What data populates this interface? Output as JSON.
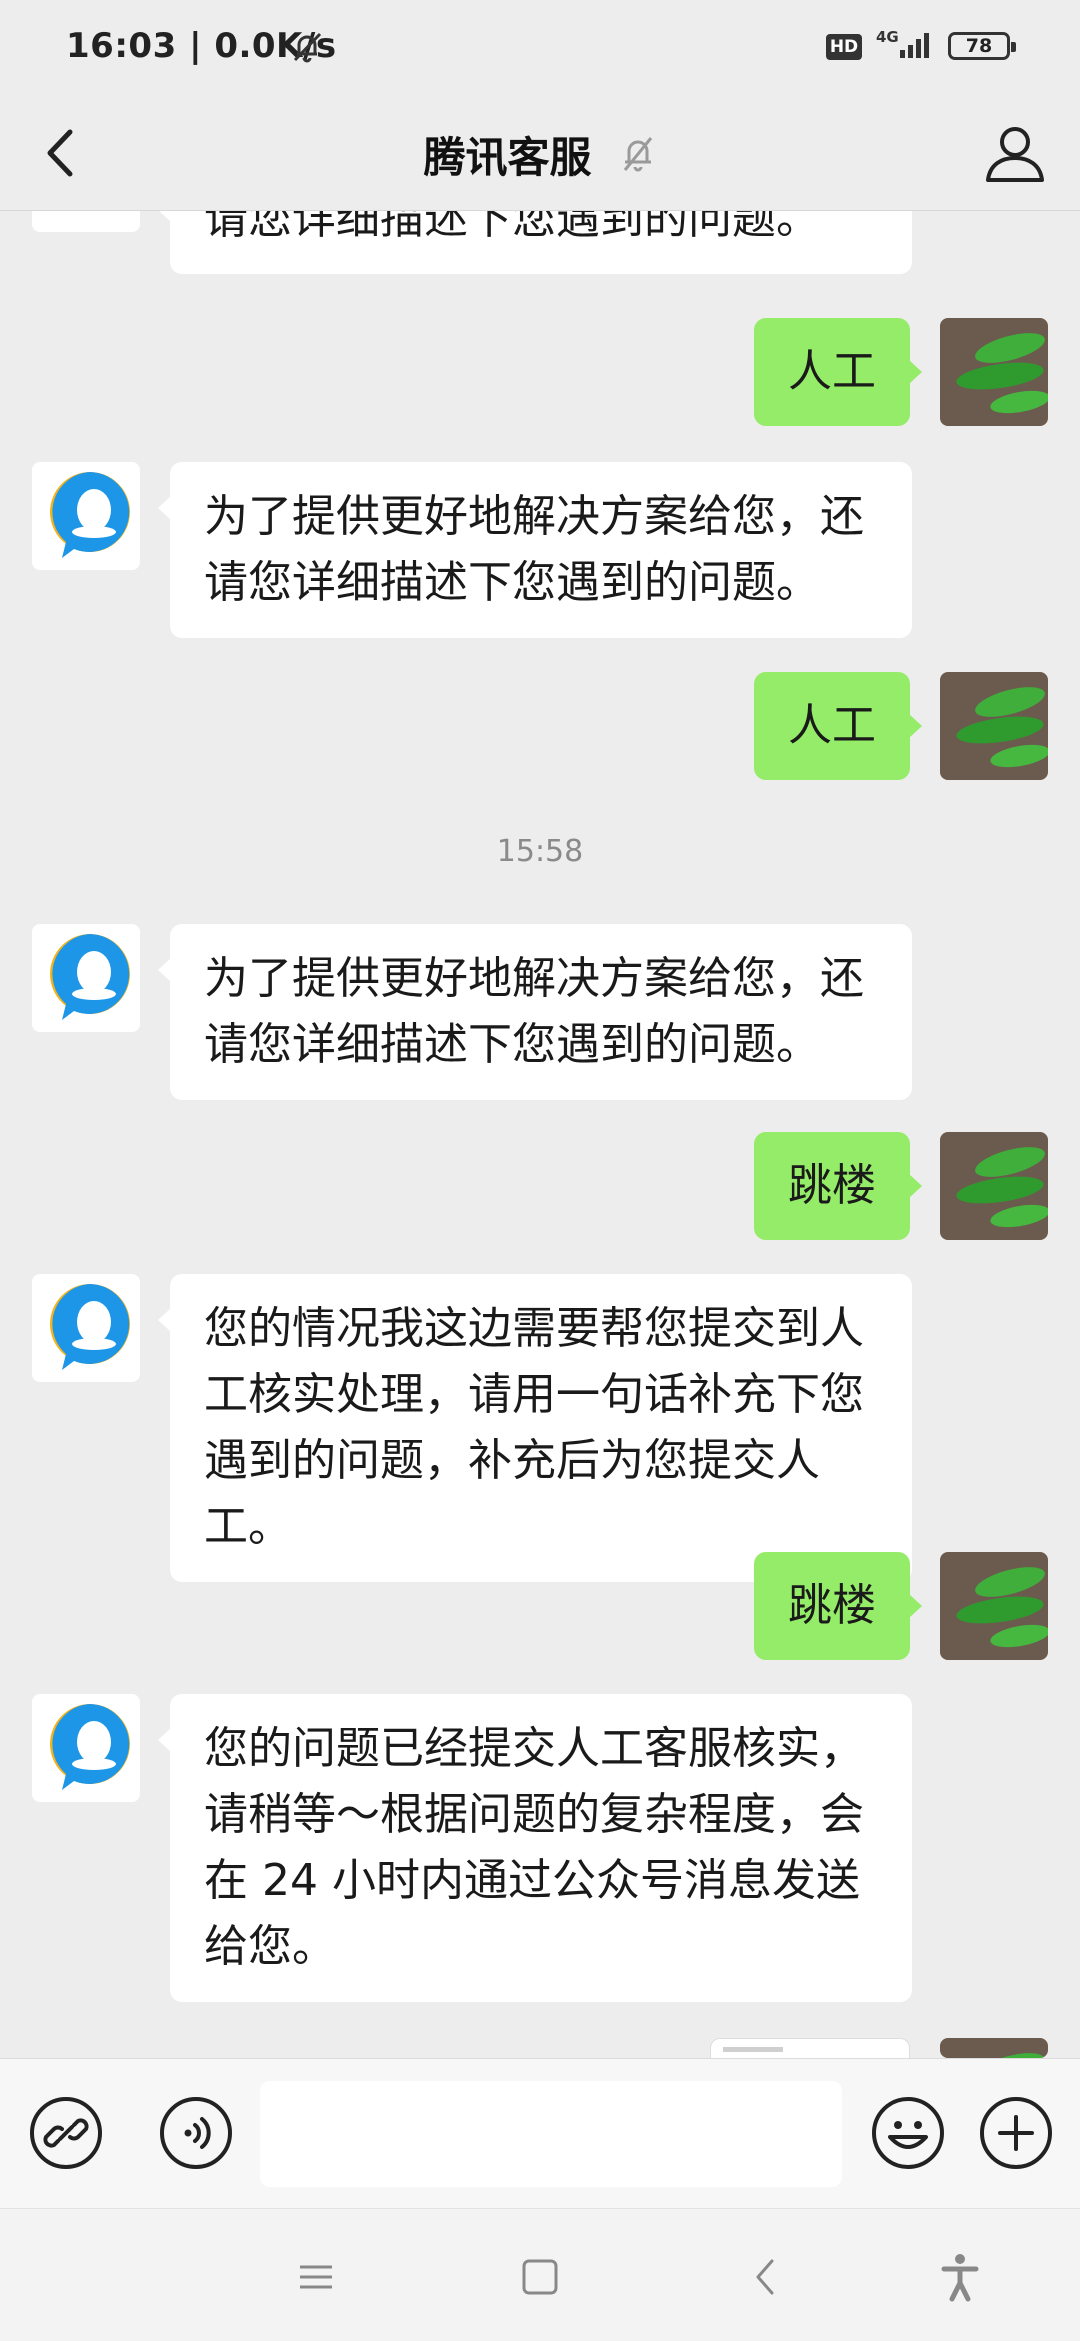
{
  "status_bar": {
    "time": "16:03 | 0.0K/s",
    "hd": "HD",
    "network": "4G",
    "battery": "78"
  },
  "header": {
    "title": "腾讯客服"
  },
  "chat": {
    "timestamp": "15:58",
    "messages": [
      {
        "from": "bot",
        "text": "请您详细描述下您遇到的问题。"
      },
      {
        "from": "user",
        "text": "人工"
      },
      {
        "from": "bot",
        "text": "为了提供更好地解决方案给您，还请您详细描述下您遇到的问题。"
      },
      {
        "from": "user",
        "text": "人工"
      },
      {
        "from": "bot",
        "text": "为了提供更好地解决方案给您，还请您详细描述下您遇到的问题。"
      },
      {
        "from": "user",
        "text": "跳楼"
      },
      {
        "from": "bot",
        "text": "您的情况我这边需要帮您提交到人工核实处理，请用一句话补充下您遇到的问题，补充后为您提交人工。"
      },
      {
        "from": "user",
        "text": "跳楼"
      },
      {
        "from": "bot",
        "text": "您的问题已经提交人工客服核实，请稍等～根据问题的复杂程度，会在 24 小时内通过公众号消息发送给您。"
      }
    ]
  },
  "input": {
    "value": ""
  },
  "colors": {
    "background": "#ededed",
    "user_bubble": "#95ec69",
    "bot_bubble": "#ffffff",
    "accent": "#1e96e8"
  },
  "icons": {
    "back": "chevron-left-icon",
    "mute": "bell-off-icon",
    "profile": "person-icon",
    "link": "link-icon",
    "voice": "voice-icon",
    "emoji": "smile-icon",
    "plus": "plus-icon",
    "menu": "menu-icon",
    "home": "square-icon",
    "nav_back": "triangle-back-icon",
    "accessibility": "accessibility-icon"
  }
}
